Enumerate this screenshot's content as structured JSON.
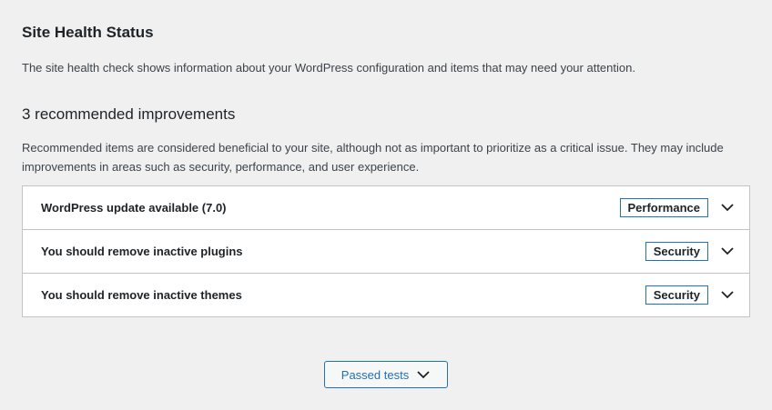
{
  "header": {
    "title": "Site Health Status",
    "description": "The site health check shows information about your WordPress configuration and items that may need your attention."
  },
  "recommended": {
    "heading": "3 recommended improvements",
    "description": "Recommended items are considered beneficial to your site, although not as important to prioritize as a critical issue. They may include improvements in areas such as security, performance, and user experience.",
    "items": [
      {
        "label": "WordPress update available (7.0)",
        "badge": "Performance",
        "icon": "chevron-down-icon"
      },
      {
        "label": "You should remove inactive plugins",
        "badge": "Security",
        "icon": "chevron-down-icon"
      },
      {
        "label": "You should remove inactive themes",
        "badge": "Security",
        "icon": "chevron-down-icon"
      }
    ]
  },
  "footer": {
    "passed_tests_label": "Passed tests",
    "icon": "chevron-down-icon"
  },
  "colors": {
    "background": "#f0f0f1",
    "accent": "#2271b1",
    "border": "#c3c4c7"
  }
}
